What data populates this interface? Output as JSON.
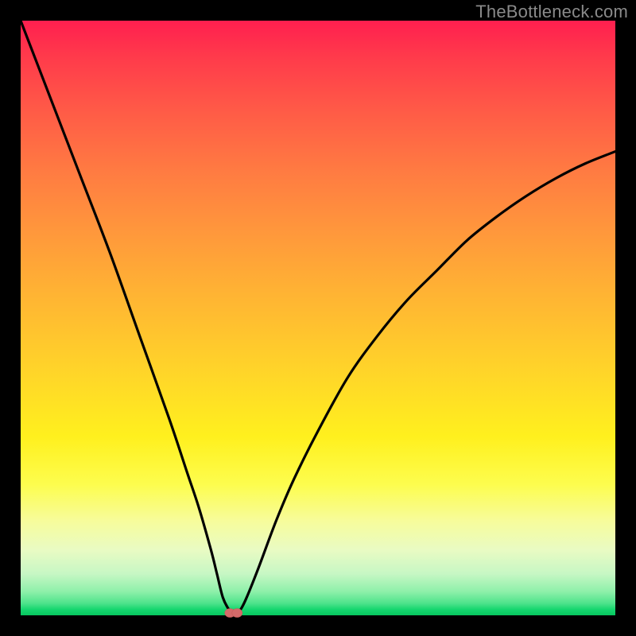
{
  "watermark": "TheBottleneck.com",
  "colors": {
    "frame_bg": "#000000",
    "curve_stroke": "#000000",
    "marker_fill": "#d46a6a",
    "gradient_top": "#ff1f4f",
    "gradient_bottom": "#07c65f"
  },
  "chart_data": {
    "type": "line",
    "title": "",
    "xlabel": "",
    "ylabel": "",
    "xlim": [
      0,
      100
    ],
    "ylim": [
      0,
      100
    ],
    "series": [
      {
        "name": "bottleneck-curve",
        "x": [
          0,
          5,
          10,
          15,
          20,
          25,
          28,
          30,
          32,
          33,
          34,
          35,
          36,
          37,
          38,
          40,
          43,
          46,
          50,
          55,
          60,
          65,
          70,
          75,
          80,
          85,
          90,
          95,
          100
        ],
        "y": [
          100,
          87,
          74,
          61,
          47,
          33,
          24,
          18,
          11,
          7,
          3,
          1,
          0,
          1,
          3,
          8,
          16,
          23,
          31,
          40,
          47,
          53,
          58,
          63,
          67,
          70.5,
          73.5,
          76,
          78
        ]
      }
    ],
    "markers": [
      {
        "name": "min-point-left",
        "x": 35.2,
        "y": 0.4
      },
      {
        "name": "min-point-right",
        "x": 36.4,
        "y": 0.4
      }
    ],
    "annotations": []
  }
}
